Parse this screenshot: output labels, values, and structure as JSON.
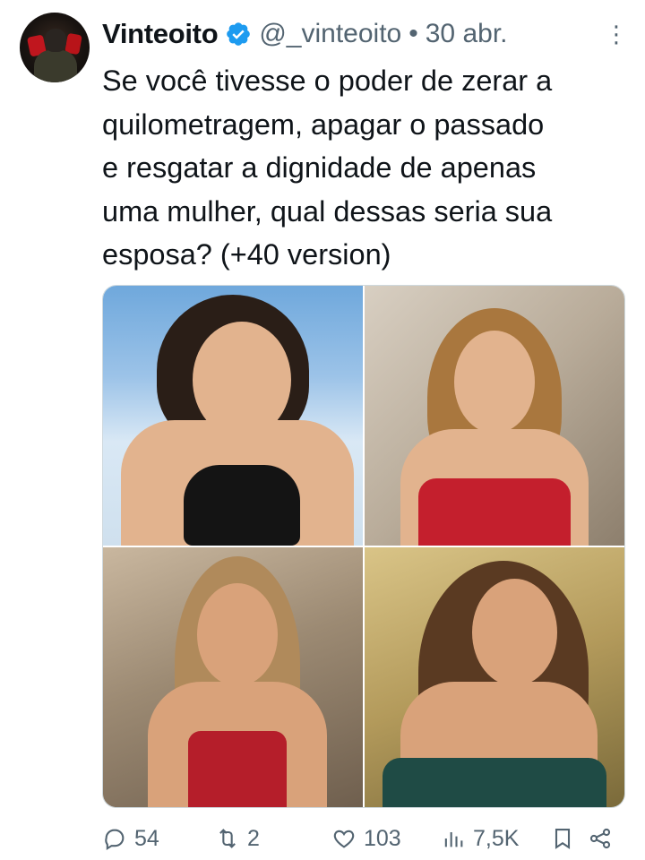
{
  "author": {
    "name": "Vinteoito",
    "handle": "@_vinteoito",
    "separator": "•",
    "date": "30 abr.",
    "verified": true
  },
  "tweet": {
    "text": "Se você tivesse o poder de zerar a\nquilometragem, apagar o passado\ne resgatar a dignidade de apenas\numa mulher, qual dessas seria sua\nesposa? (+40 version)"
  },
  "media": {
    "count": 4,
    "layout": "2x2 grid"
  },
  "actions": {
    "replies": "54",
    "retweets": "2",
    "likes": "103",
    "views": "7,5K"
  },
  "colors": {
    "text": "#0f1419",
    "secondary": "#536471",
    "verified": "#1d9bf0"
  }
}
